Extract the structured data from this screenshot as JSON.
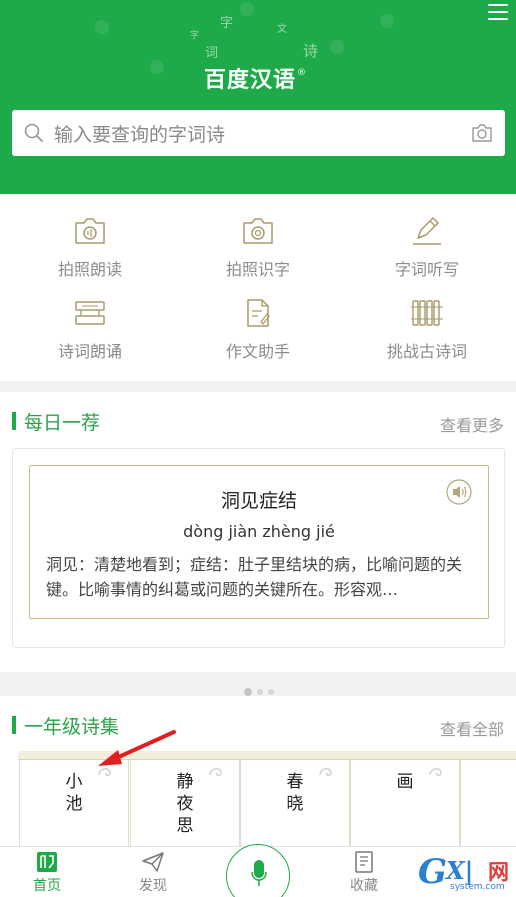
{
  "header": {
    "logo_text": "百度汉语",
    "logo_mark": "®",
    "decor_chars": [
      "字",
      "文",
      "词",
      "诗",
      "字"
    ],
    "search_placeholder": "输入要查询的字词诗"
  },
  "tools": [
    {
      "label": "拍照朗读",
      "icon": "camera-read-icon"
    },
    {
      "label": "拍照识字",
      "icon": "camera-scan-icon"
    },
    {
      "label": "字词听写",
      "icon": "pen-icon"
    },
    {
      "label": "诗词朗诵",
      "icon": "scroll-icon"
    },
    {
      "label": "作文助手",
      "icon": "essay-icon"
    },
    {
      "label": "挑战古诗词",
      "icon": "bamboo-slips-icon"
    }
  ],
  "daily": {
    "title": "每日一荐",
    "more": "查看更多",
    "word": "洞见症结",
    "pinyin": "dòng jiàn zhèng jié",
    "definition": "洞见：清楚地看到；症结：肚子里结块的病，比喻问题的关键。比喻事情的纠葛或问题的关键所在。形容观…",
    "page_count": 3,
    "active_page": 1
  },
  "poems": {
    "title": "一年级诗集",
    "more": "查看全部",
    "items": [
      {
        "chars": [
          "小",
          "池"
        ]
      },
      {
        "chars": [
          "静",
          "夜",
          "思"
        ]
      },
      {
        "chars": [
          "春",
          "晓"
        ]
      },
      {
        "chars": [
          "画"
        ]
      }
    ]
  },
  "nav": {
    "items": [
      {
        "label": "首页",
        "icon": "home-icon",
        "active": true
      },
      {
        "label": "发现",
        "icon": "paper-plane-icon",
        "active": false
      },
      {
        "label": "收藏",
        "icon": "bookmark-icon",
        "active": false
      }
    ],
    "mic_icon": "microphone-icon"
  },
  "watermark": {
    "g": "G",
    "xi": "X|",
    "net": "网",
    "site": "system.com"
  },
  "colors": {
    "brand_green": "#1faa4a",
    "card_border": "#c9b98a",
    "arrow_red": "#e02020"
  }
}
